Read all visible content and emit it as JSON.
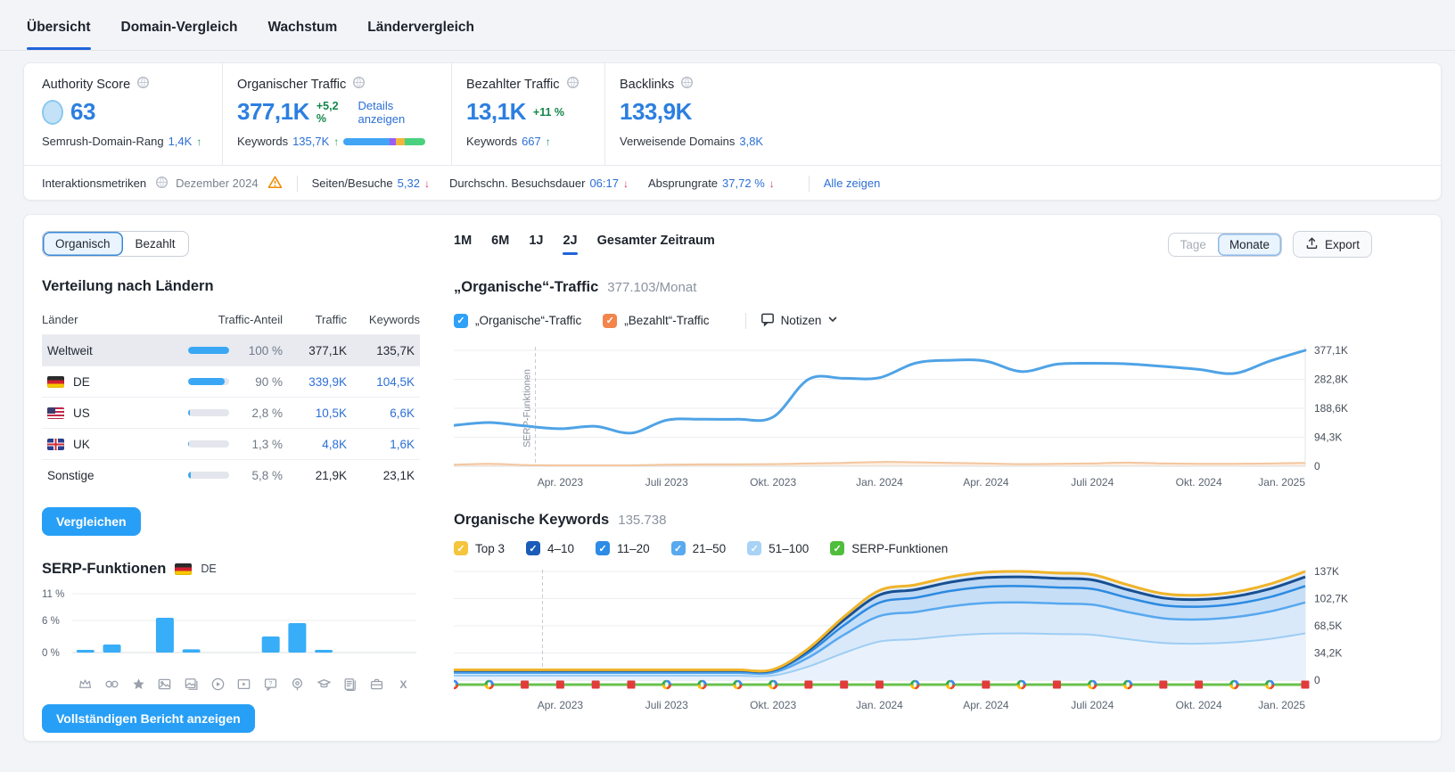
{
  "nav": {
    "tabs": [
      {
        "label": "Übersicht",
        "active": true
      },
      {
        "label": "Domain-Vergleich",
        "active": false
      },
      {
        "label": "Wachstum",
        "active": false
      },
      {
        "label": "Ländervergleich",
        "active": false
      }
    ]
  },
  "metrics": {
    "authority": {
      "title": "Authority Score",
      "value": "63",
      "sub_label": "Semrush-Domain-Rang",
      "sub_value": "1,4K",
      "sub_arrow": "↑"
    },
    "organic": {
      "title": "Organischer Traffic",
      "value": "377,1K",
      "delta": "+5,2 %",
      "link": "Details anzeigen",
      "sub_label": "Keywords",
      "sub_value": "135,7K",
      "sub_arrow": "↑",
      "bar_segments": [
        {
          "color": "#41a4f5",
          "pct": 56
        },
        {
          "color": "#9b5cf6",
          "pct": 8
        },
        {
          "color": "#f2b63c",
          "pct": 11
        },
        {
          "color": "#49d17f",
          "pct": 25
        }
      ]
    },
    "paid": {
      "title": "Bezahlter Traffic",
      "value": "13,1K",
      "delta": "+11 %",
      "sub_label": "Keywords",
      "sub_value": "667",
      "sub_arrow": "↑"
    },
    "backlinks": {
      "title": "Backlinks",
      "value": "133,9K",
      "sub_label": "Verweisende Domains",
      "sub_value": "3,8K"
    }
  },
  "engagement": {
    "title": "Interaktionsmetriken",
    "period": "Dezember 2024",
    "items": [
      {
        "label": "Seiten/Besuche",
        "value": "5,32",
        "arrow": "↓"
      },
      {
        "label": "Durchschn. Besuchsdauer",
        "value": "06:17",
        "arrow": "↓"
      },
      {
        "label": "Absprungrate",
        "value": "37,72 %",
        "arrow": "↓"
      }
    ],
    "link": "Alle zeigen"
  },
  "left": {
    "toggle": {
      "organic": "Organisch",
      "paid": "Bezahlt"
    },
    "countries": {
      "title": "Verteilung nach Ländern",
      "headers": [
        "Länder",
        "Traffic-Anteil",
        "Traffic",
        "Keywords"
      ],
      "rows": [
        {
          "name": "Weltweit",
          "flag": "",
          "share": "100 %",
          "share_pct": 100,
          "traffic": "377,1K",
          "keywords": "135,7K",
          "selected": true,
          "link": false
        },
        {
          "name": "DE",
          "flag": "de",
          "share": "90 %",
          "share_pct": 90,
          "traffic": "339,9K",
          "keywords": "104,5K",
          "selected": false,
          "link": true
        },
        {
          "name": "US",
          "flag": "us",
          "share": "2,8 %",
          "share_pct": 4,
          "traffic": "10,5K",
          "keywords": "6,6K",
          "selected": false,
          "link": true
        },
        {
          "name": "UK",
          "flag": "uk",
          "share": "1,3 %",
          "share_pct": 2,
          "traffic": "4,8K",
          "keywords": "1,6K",
          "selected": false,
          "link": true
        },
        {
          "name": "Sonstige",
          "flag": "",
          "share": "5,8 %",
          "share_pct": 7,
          "traffic": "21,9K",
          "keywords": "23,1K",
          "selected": false,
          "link": false
        }
      ],
      "compare_button": "Vergleichen"
    },
    "serp": {
      "title": "SERP-Funktionen",
      "flag_label": "DE",
      "report_button": "Vollständigen Bericht anzeigen"
    }
  },
  "right": {
    "ranges": [
      {
        "label": "1M"
      },
      {
        "label": "6M"
      },
      {
        "label": "1J"
      },
      {
        "label": "2J"
      },
      {
        "label": "Gesamter Zeitraum"
      }
    ],
    "view_toggle": {
      "days": "Tage",
      "months": "Monate"
    },
    "export_label": "Export",
    "traffic": {
      "title": "„Organische“-Traffic",
      "subtitle": "377.103/Monat",
      "legend": [
        {
          "label": "„Organische“-Traffic",
          "color": "#2ea1f8"
        },
        {
          "label": "„Bezahlt“-Traffic",
          "color": "#f2854b"
        }
      ],
      "notes_label": "Notizen"
    },
    "keywords": {
      "title": "Organische Keywords",
      "subtitle": "135.738",
      "legend": [
        {
          "label": "Top 3",
          "color": "#f4c53d"
        },
        {
          "label": "4–10",
          "color": "#1a5cb8"
        },
        {
          "label": "11–20",
          "color": "#2e8be6"
        },
        {
          "label": "21–50",
          "color": "#58a9ef"
        },
        {
          "label": "51–100",
          "color": "#a8d2f6"
        },
        {
          "label": "SERP-Funktionen",
          "color": "#4fbe3c"
        }
      ]
    }
  },
  "chart_data": [
    {
      "id": "traffic",
      "type": "line",
      "title": "„Organische“-Traffic (377.103/Monat)",
      "x_months": "Jan 2023 – Jan 2025, monatlich",
      "x_labels": [
        {
          "i": 3,
          "label": "Apr. 2023"
        },
        {
          "i": 6,
          "label": "Juli 2023"
        },
        {
          "i": 9,
          "label": "Okt. 2023"
        },
        {
          "i": 12,
          "label": "Jan. 2024"
        },
        {
          "i": 15,
          "label": "Apr. 2024"
        },
        {
          "i": 18,
          "label": "Juli 2024"
        },
        {
          "i": 21,
          "label": "Okt. 2024"
        },
        {
          "i": 24,
          "label": "Jan. 2025"
        }
      ],
      "y_ticks": [
        {
          "v": 377.1,
          "label": "377,1K"
        },
        {
          "v": 282.8,
          "label": "282,8K"
        },
        {
          "v": 188.6,
          "label": "188,6K"
        },
        {
          "v": 94.3,
          "label": "94,3K"
        },
        {
          "v": 0,
          "label": "0"
        }
      ],
      "ylim": [
        0,
        377.1
      ],
      "annotation": {
        "label": "SERP-Funktionen",
        "month_index": 2.3
      },
      "series": [
        {
          "name": "Organische-Traffic",
          "color": "#4fa3e6",
          "unit": "K",
          "values": [
            133,
            142,
            131,
            122,
            130,
            108,
            150,
            153,
            153,
            160,
            283,
            286,
            288,
            335,
            345,
            342,
            308,
            332,
            335,
            333,
            325,
            315,
            302,
            342,
            377
          ]
        },
        {
          "name": "Bezahlt-Traffic",
          "color": "#f3c69e",
          "fill": "rgba(246,205,172,0.35)",
          "unit": "K",
          "values": [
            5,
            8,
            4,
            3,
            3,
            3,
            5,
            6,
            6,
            7,
            9,
            11,
            14,
            13,
            11,
            9,
            7,
            8,
            9,
            12,
            9,
            8,
            8,
            9,
            11
          ]
        }
      ]
    },
    {
      "id": "keywords",
      "type": "stacked-area",
      "title": "Organische Keywords (135.738)",
      "x_labels": [
        {
          "i": 3,
          "label": "Apr. 2023"
        },
        {
          "i": 6,
          "label": "Juli 2023"
        },
        {
          "i": 9,
          "label": "Okt. 2023"
        },
        {
          "i": 12,
          "label": "Jan. 2024"
        },
        {
          "i": 15,
          "label": "Apr. 2024"
        },
        {
          "i": 18,
          "label": "Juli 2024"
        },
        {
          "i": 21,
          "label": "Okt. 2024"
        },
        {
          "i": 24,
          "label": "Jan. 2025"
        }
      ],
      "y_ticks": [
        {
          "v": 137,
          "label": "137K"
        },
        {
          "v": 102.75,
          "label": "102,7K"
        },
        {
          "v": 68.5,
          "label": "68,5K"
        },
        {
          "v": 34.25,
          "label": "34,2K"
        },
        {
          "v": 0,
          "label": "0"
        }
      ],
      "ylim": [
        0,
        137
      ],
      "totals_k": [
        13,
        13,
        13,
        13,
        13,
        13,
        13,
        13,
        13,
        13.5,
        40,
        80,
        113,
        120,
        130,
        136,
        137,
        135,
        133,
        120,
        109,
        107,
        111,
        121,
        137
      ],
      "stack_bottom_up": [
        "51–100",
        "21–50",
        "11–20",
        "4–10",
        "Top 3"
      ],
      "stack_shares_bottom_up": [
        0.43,
        0.285,
        0.15,
        0.085,
        0.05
      ],
      "band_fills_top_down": [
        "#e2edfa",
        "#bdd8f5",
        "#c7def7",
        "#d9e9fa",
        "#e9f2fc"
      ],
      "boundary_colors_bottom_up": [
        "#9dcdf4",
        "#57a8ef",
        "#2b8ae0",
        "#174f92",
        "#f0b429"
      ],
      "boundary_widths_bottom_up": [
        2,
        2.5,
        2.5,
        3,
        3
      ],
      "annotation": {
        "month_index": 2.5
      },
      "serp_line": {
        "color": "#69c14e",
        "value": "SERP-Funktionen",
        "markers": [
          "g",
          "g",
          "f",
          "f",
          "f",
          "f",
          "g",
          "g",
          "g",
          "g",
          "f",
          "f",
          "f",
          "g",
          "g",
          "f",
          "g",
          "f",
          "g",
          "g",
          "f",
          "f",
          "g",
          "g",
          "f"
        ]
      }
    },
    {
      "id": "serp_features",
      "type": "bar",
      "title": "SERP-Funktionen (DE)",
      "bar_color": "#38adf8",
      "ylim": [
        0,
        11
      ],
      "y_ticks": [
        {
          "v": 11,
          "label": "11 %"
        },
        {
          "v": 6,
          "label": "6 %"
        },
        {
          "v": 0,
          "label": "0 %"
        }
      ],
      "categories": [
        "sitelinks",
        "link",
        "star",
        "image",
        "image-pack",
        "video",
        "featured-video",
        "faq",
        "local-pack",
        "knowledge-panel",
        "news",
        "jobs",
        "twitter"
      ],
      "values": [
        0.5,
        1.5,
        0,
        6.5,
        0.6,
        0,
        0,
        3,
        5.5,
        0.5,
        0,
        0,
        0
      ]
    }
  ]
}
